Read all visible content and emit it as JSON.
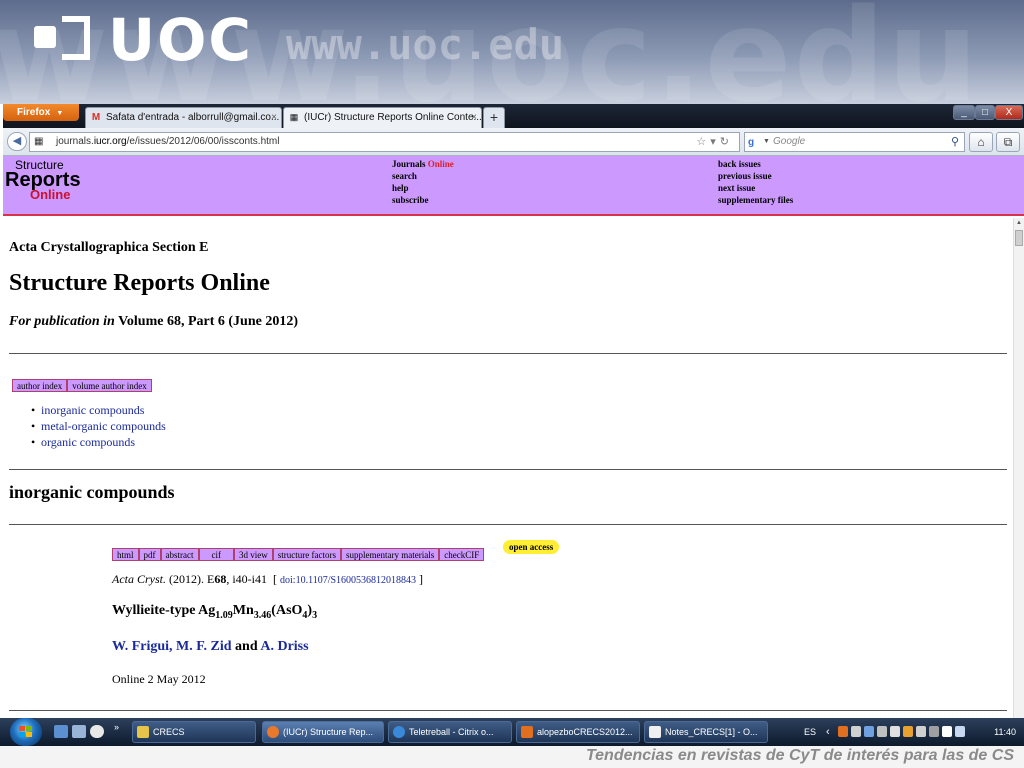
{
  "banner": {
    "logo": "UOC",
    "url": "www.uoc.edu",
    "watermark": "www.uoc.edu"
  },
  "browser": {
    "firefox_button": "Firefox",
    "tabs": [
      {
        "label": "Safata d'entrada - alborrull@gmail.co...",
        "icon": "gmail-icon"
      },
      {
        "label": "(IUCr) Structure Reports Online Conte...",
        "icon": "iucr-icon"
      }
    ],
    "new_tab": "+",
    "window_controls": [
      "_",
      "□",
      "X"
    ],
    "url": {
      "prefix": "journals.",
      "domain": "iucr.org",
      "path": "/e/issues/2012/06/00/issconts.html"
    },
    "search_placeholder": "Google"
  },
  "iucr_header": {
    "logo": {
      "line1": "Structure",
      "line2": "Reports",
      "line3": "Online"
    },
    "nav_left": [
      {
        "label": "Journals",
        "suffix": "Online"
      },
      {
        "label": "search"
      },
      {
        "label": "help"
      },
      {
        "label": "subscribe"
      }
    ],
    "nav_right": [
      "back issues",
      "previous issue",
      "next issue",
      "supplementary files"
    ]
  },
  "content": {
    "journal": "Acta Crystallographica Section E",
    "title": "Structure Reports Online",
    "pub_prefix": "For publication in",
    "pub_rest": "Volume 68, Part 6 (June 2012)",
    "index_buttons": [
      "author index",
      "volume author index"
    ],
    "toc": [
      "inorganic compounds",
      "metal-organic compounds",
      "organic compounds"
    ],
    "section_heading": "inorganic compounds",
    "article_buttons": [
      "html",
      "pdf",
      "abstract",
      "cif",
      "3d view",
      "structure factors",
      "supplementary materials",
      "checkCIF"
    ],
    "open_access": "open access",
    "citation": {
      "journal": "Acta Cryst.",
      "year": "(2012).",
      "vol_letter": "E",
      "vol": "68",
      "pages": ", i40-i41",
      "doi": "doi:10.1107/S1600536812018843"
    },
    "article_title": {
      "part1": "Wyllieite-type Ag",
      "sub1": "1.09",
      "part2": "Mn",
      "sub2": "3.46",
      "part3": "(AsO",
      "sub3": "4",
      "part4": ")",
      "sub4": "3"
    },
    "authors": {
      "a1": "W. Frigui",
      "sep": ", ",
      "a2": "M. F. Zid",
      "and": " and ",
      "a3": "A. Driss"
    },
    "online_date": "Online 2 May 2012"
  },
  "taskbar": {
    "buttons": [
      {
        "label": "CRECS"
      },
      {
        "label": "(IUCr) Structure Rep..."
      },
      {
        "label": "Teletreball - Citrix o..."
      },
      {
        "label": "alopezboCRECS2012..."
      },
      {
        "label": "Notes_CRECS[1] - O..."
      }
    ],
    "lang": "ES",
    "clock": "11:40"
  },
  "caption": "Tendencias en revistas de CyT de interés para las de CS",
  "colors": {
    "iucr_purple": "#cc99ff",
    "iucr_red": "#d8334a",
    "link_blue": "#1a2a9a",
    "open_access_yellow": "#ffee33"
  }
}
